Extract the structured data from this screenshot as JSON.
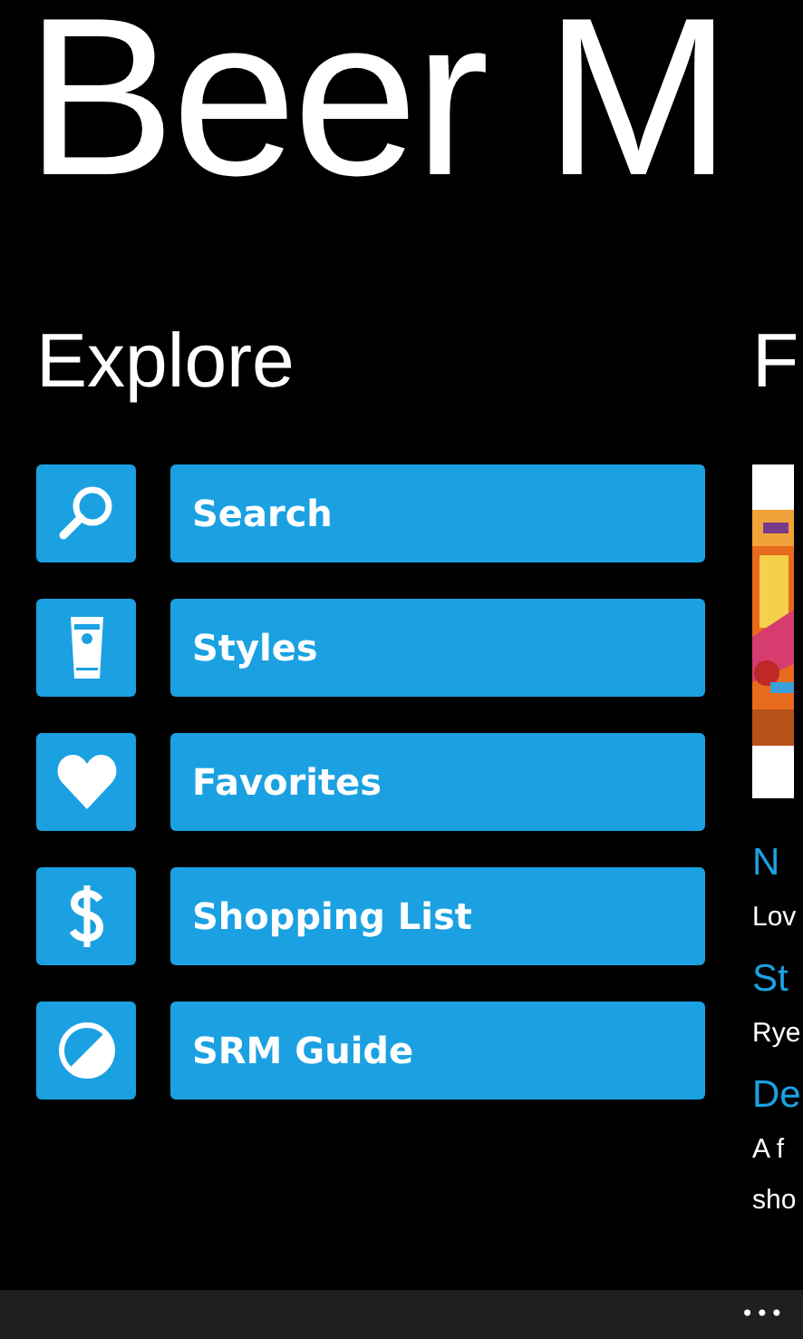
{
  "app_title": "Beer M",
  "explore": {
    "heading": "Explore",
    "items": [
      {
        "label": "Search"
      },
      {
        "label": "Styles"
      },
      {
        "label": "Favorites"
      },
      {
        "label": "Shopping List"
      },
      {
        "label": "SRM Guide"
      }
    ]
  },
  "featured": {
    "heading": "F",
    "entries": [
      {
        "kind": "title",
        "text": "N"
      },
      {
        "kind": "body",
        "text": "Lov"
      },
      {
        "kind": "title",
        "text": "St"
      },
      {
        "kind": "body",
        "text": "Rye"
      },
      {
        "kind": "title",
        "text": "De"
      },
      {
        "kind": "body",
        "text": "A f"
      },
      {
        "kind": "body",
        "text": "sho"
      }
    ]
  },
  "app_bar": {
    "more": "•••"
  }
}
